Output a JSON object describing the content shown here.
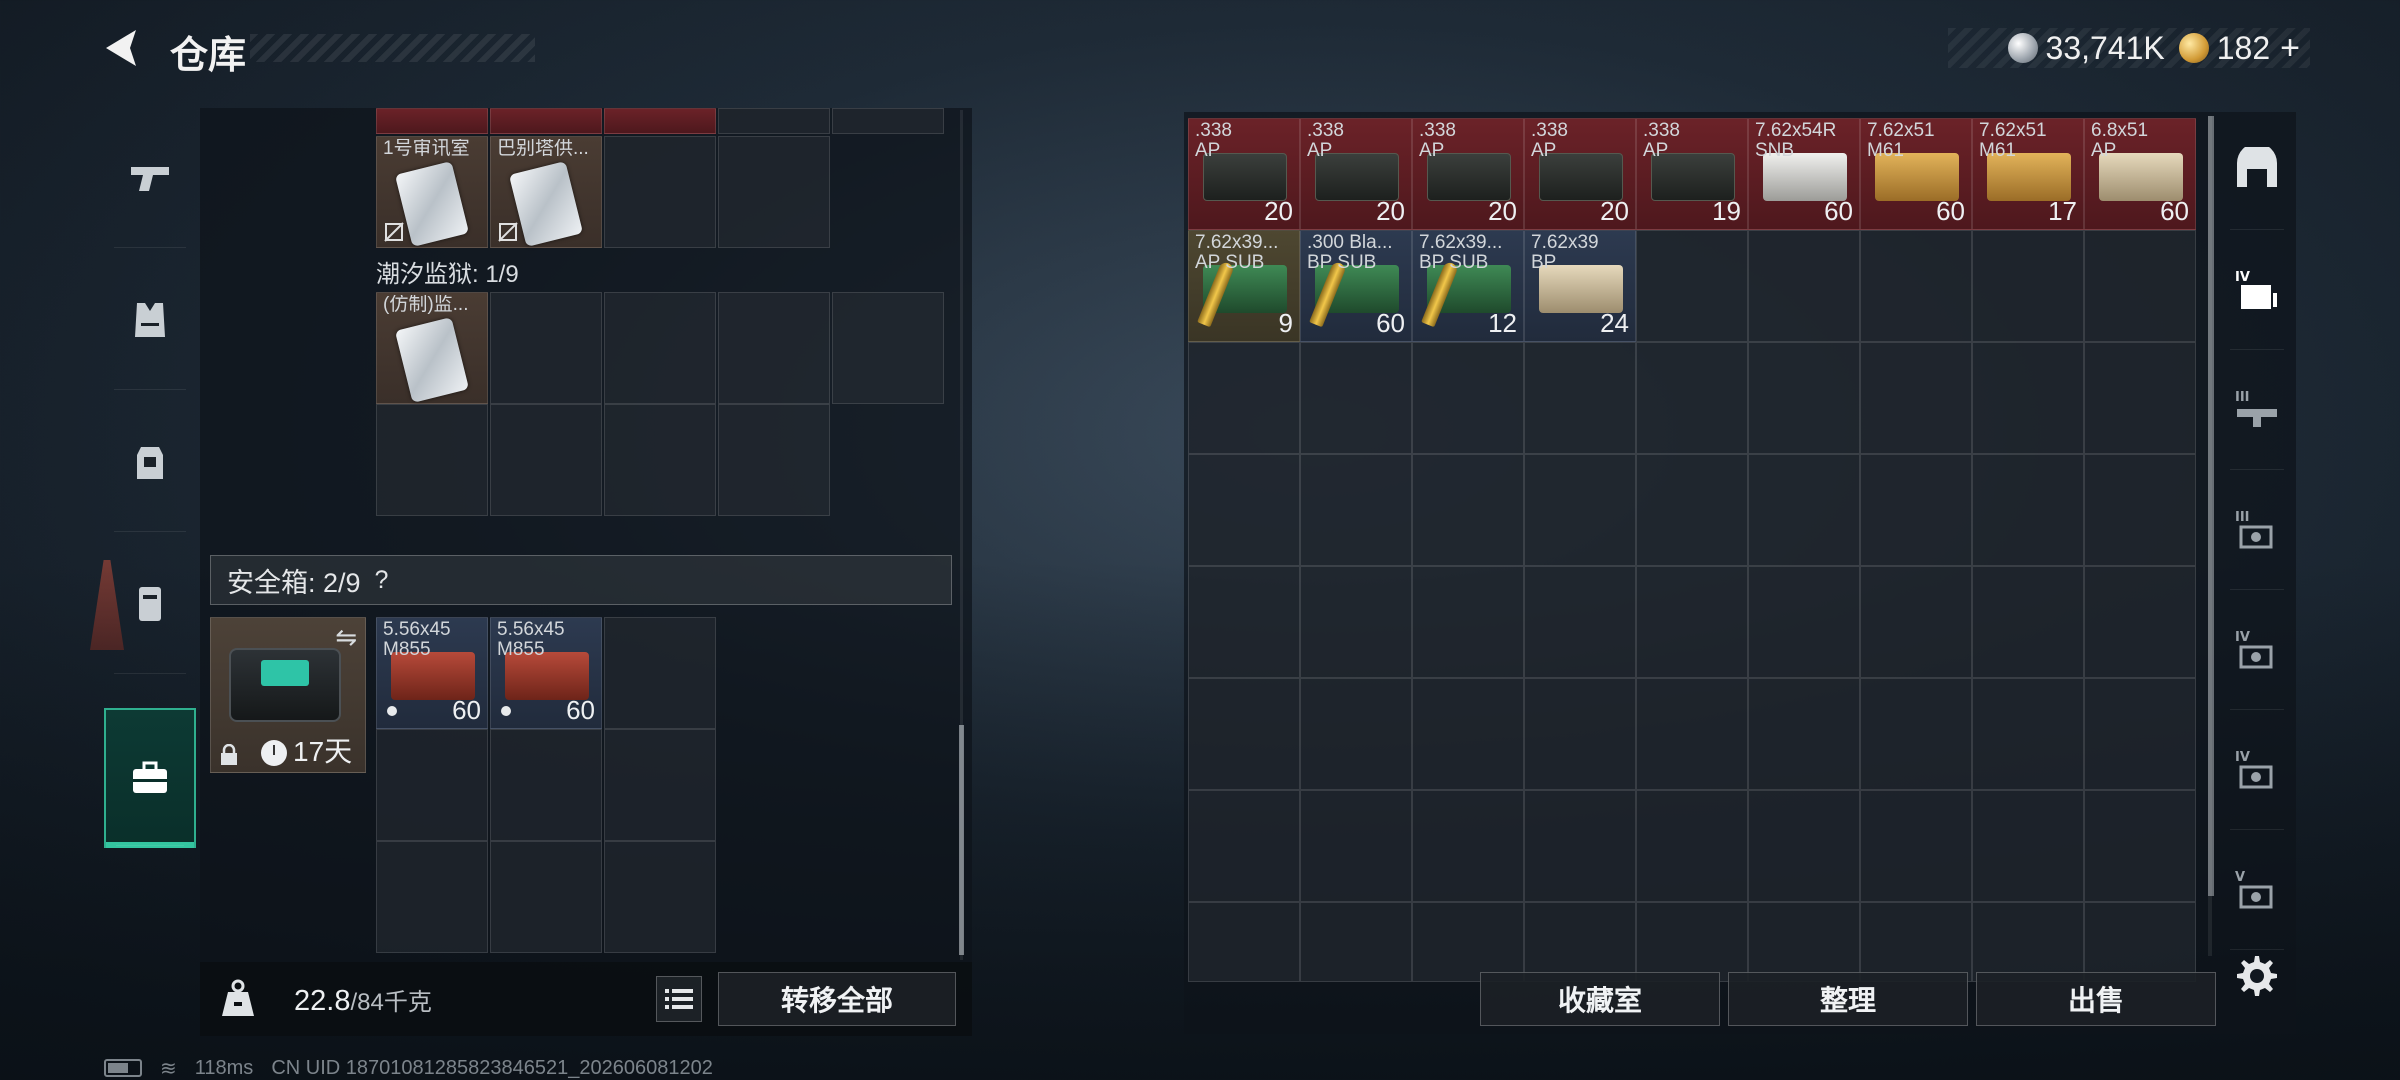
{
  "header": {
    "title": "仓库",
    "currency": [
      {
        "icon": "silver-coin-icon",
        "value": "33,741K"
      },
      {
        "icon": "gold-coin-icon",
        "value": "182"
      }
    ],
    "plus": "+"
  },
  "left_nav": [
    {
      "name": "weapons",
      "icon": "pistol-icon"
    },
    {
      "name": "armor",
      "icon": "vest-icon"
    },
    {
      "name": "backpack",
      "icon": "backpack-icon"
    },
    {
      "name": "rig",
      "icon": "rig-icon"
    },
    {
      "name": "safe-box",
      "icon": "briefcase-icon",
      "active": true
    }
  ],
  "left_grid": {
    "top_items": [
      {
        "label": "1号审讯室",
        "col": 0
      },
      {
        "label": "巴别塔供...",
        "col": 1
      }
    ],
    "prison_label": "潮汐监狱: 1/9",
    "prison_items": [
      {
        "label": "(仿制)监..."
      }
    ]
  },
  "safe_box": {
    "label": "安全箱: 2/9",
    "help": "?",
    "swap": "⇋",
    "days": "17天",
    "items": [
      {
        "label": "5.56x45\nM855",
        "count": "60"
      },
      {
        "label": "5.56x45\nM855",
        "count": "60"
      }
    ]
  },
  "left_footer": {
    "weight": "22.8",
    "capacity": "/84千克",
    "transfer_all": "转移全部"
  },
  "stash_items": [
    {
      "label": ".338\nAP",
      "count": "20",
      "box": "dark",
      "bg": "item-red"
    },
    {
      "label": ".338\nAP",
      "count": "20",
      "box": "dark",
      "bg": "item-red"
    },
    {
      "label": ".338\nAP",
      "count": "20",
      "box": "dark",
      "bg": "item-red"
    },
    {
      "label": ".338\nAP",
      "count": "20",
      "box": "dark",
      "bg": "item-red"
    },
    {
      "label": ".338\nAP",
      "count": "19",
      "box": "dark",
      "bg": "item-red"
    },
    {
      "label": "7.62x54R\nSNB",
      "count": "60",
      "box": "white",
      "bg": "item-red"
    },
    {
      "label": "7.62x51\nM61",
      "count": "60",
      "box": "tan",
      "bg": "item-red"
    },
    {
      "label": "7.62x51\nM61",
      "count": "17",
      "box": "tan",
      "bg": "item-red"
    },
    {
      "label": "6.8x51\nAP",
      "count": "60",
      "box": "cream",
      "bg": "item-red"
    },
    {
      "label": "7.62x39...\nAP SUB",
      "count": "9",
      "box": "green",
      "bg": "item-gold",
      "bullet": true
    },
    {
      "label": ".300 Bla...\nBP SUB",
      "count": "60",
      "box": "green",
      "bg": "item-blue",
      "bullet": true
    },
    {
      "label": "7.62x39...\nBP SUB",
      "count": "12",
      "box": "green",
      "bg": "item-blue",
      "bullet": true
    },
    {
      "label": "7.62x39\nBP",
      "count": "24",
      "box": "cream",
      "bg": "item-blue"
    }
  ],
  "right_footer": {
    "collection": "收藏室",
    "sort": "整理",
    "sell": "出售"
  },
  "right_nav": [
    {
      "name": "all",
      "icon": "stash-icon"
    },
    {
      "name": "ammo-iv",
      "icon": "ammo-case-iv-icon",
      "tier": "IV"
    },
    {
      "name": "weapon-iii",
      "icon": "rifle-iii-icon",
      "tier": "III"
    },
    {
      "name": "gear-iii",
      "icon": "gear-iii-icon",
      "tier": "III"
    },
    {
      "name": "item-iv",
      "icon": "item-iv-icon",
      "tier": "IV"
    },
    {
      "name": "item-iv-b",
      "icon": "item-iv-b-icon",
      "tier": "IV"
    },
    {
      "name": "item-v",
      "icon": "item-v-icon",
      "tier": "V"
    }
  ],
  "status_bar": {
    "ping": "118ms",
    "uid": "CN UID 18701081285823846521_202606081202"
  },
  "colors": {
    "accent": "#34c5a0",
    "item_red": "#6b2228",
    "panel": "#0e141a"
  }
}
